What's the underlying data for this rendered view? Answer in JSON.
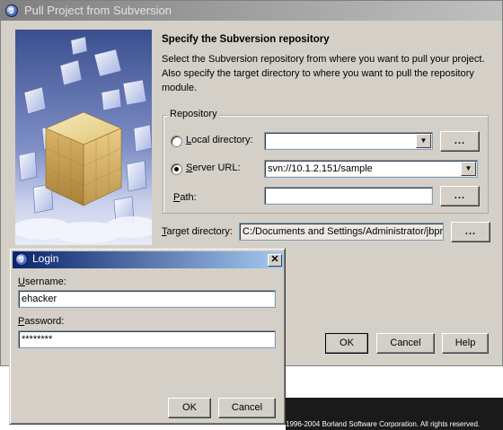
{
  "main_dialog": {
    "title": "Pull Project from Subversion",
    "heading": "Specify the Subversion repository",
    "description": "Select the Subversion repository from where you want to pull your project. Also specify the target directory to where you want to pull the repository module.",
    "repository_group": {
      "legend": "Repository",
      "local_directory": {
        "label": "Local directory:",
        "value": "",
        "selected": false
      },
      "server_url": {
        "label": "Server URL:",
        "value": "svn://10.1.2.151/sample",
        "selected": true
      },
      "path": {
        "label": "Path:",
        "value": ""
      }
    },
    "target_directory": {
      "label": "Target directory:",
      "value": "C:/Documents and Settings/Administrator/jbpro"
    },
    "browse_label": "...",
    "buttons": {
      "ok": "OK",
      "cancel": "Cancel",
      "help": "Help"
    }
  },
  "login_dialog": {
    "title": "Login",
    "close_label": "✕",
    "username": {
      "label": "Username:",
      "value": "ehacker"
    },
    "password": {
      "label": "Password:",
      "value": "********"
    },
    "buttons": {
      "ok": "OK",
      "cancel": "Cancel"
    }
  },
  "status_strip": {
    "copyright": "1996-2004 Borland Software Corporation. All rights reserved."
  },
  "colors": {
    "dialog_face": "#d4d0c8",
    "active_title_start": "#0a246a",
    "active_title_end": "#a6caf0",
    "inactive_title": "#808080"
  }
}
